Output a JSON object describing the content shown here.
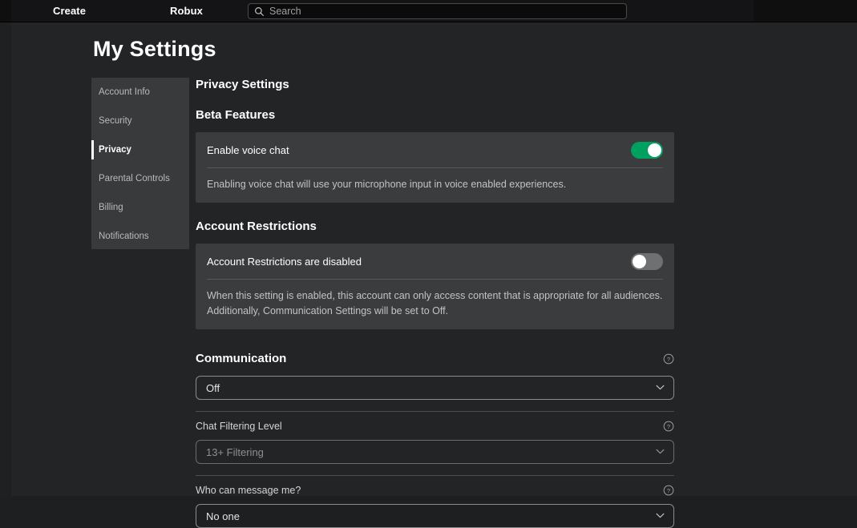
{
  "topnav": {
    "create_label": "Create",
    "robux_label": "Robux",
    "search_placeholder": "Search",
    "search_value": "",
    "search_icon": "search-icon"
  },
  "page": {
    "title": "My Settings"
  },
  "sidebar": {
    "items": [
      {
        "label": "Account Info",
        "active": false
      },
      {
        "label": "Security",
        "active": false
      },
      {
        "label": "Privacy",
        "active": true
      },
      {
        "label": "Parental Controls",
        "active": false
      },
      {
        "label": "Billing",
        "active": false
      },
      {
        "label": "Notifications",
        "active": false
      }
    ]
  },
  "content": {
    "privacy_heading": "Privacy Settings",
    "beta": {
      "heading": "Beta Features",
      "row_label": "Enable voice chat",
      "toggle_state": "on",
      "description": "Enabling voice chat will use your microphone input in voice enabled experiences."
    },
    "restrictions": {
      "heading": "Account Restrictions",
      "row_label": "Account Restrictions are disabled",
      "toggle_state": "off",
      "description": "When this setting is enabled, this account can only access content that is appropriate for all audiences. Additionally, Communication Settings will be set to Off."
    },
    "communication": {
      "heading": "Communication",
      "help_icon": "help-circle-icon",
      "fields": [
        {
          "label": "",
          "value": "Off",
          "disabled": false,
          "help_icon": "help-circle-icon",
          "chevron_icon": "chevron-down-icon"
        },
        {
          "label": "Chat Filtering Level",
          "value": "13+ Filtering",
          "disabled": true,
          "help_icon": "help-circle-icon",
          "chevron_icon": "chevron-down-icon"
        },
        {
          "label": "Who can message me?",
          "value": "No one",
          "disabled": false,
          "help_icon": "help-circle-icon",
          "chevron_icon": "chevron-down-icon"
        }
      ]
    }
  },
  "colors": {
    "page_bg": "#232426",
    "topnav_bg": "#141416",
    "sidebar_bg": "#393a3b",
    "card_bg": "#3b3c3d",
    "toggle_on": "#00a160",
    "toggle_off": "#6f7072",
    "accent_active": "#ffffff"
  }
}
